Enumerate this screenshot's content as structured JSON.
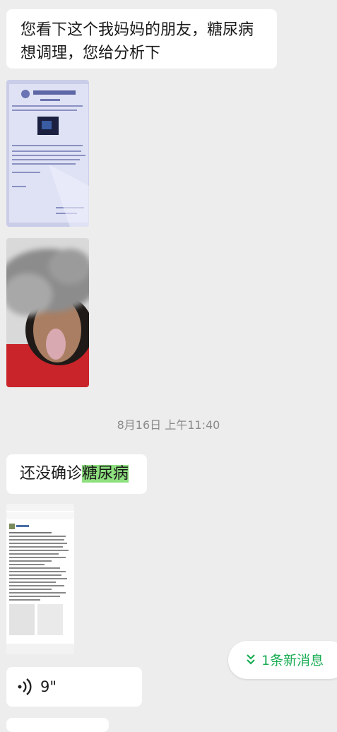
{
  "messages": {
    "m1": {
      "text_line1": "您看下这个我妈妈的朋友，糖尿病",
      "text_line2": "想调理，您给分析下"
    },
    "timestamp": "8月16日 上午11:40",
    "m2": {
      "text_before": "还没确诊",
      "text_highlight": "糖尿病"
    },
    "voice": {
      "duration": "9\""
    }
  },
  "new_message_pill": {
    "label": "1条新消息"
  },
  "colors": {
    "accent_green": "#1aad55",
    "highlight_green": "#8ee07f",
    "chat_bg": "#ededed"
  }
}
